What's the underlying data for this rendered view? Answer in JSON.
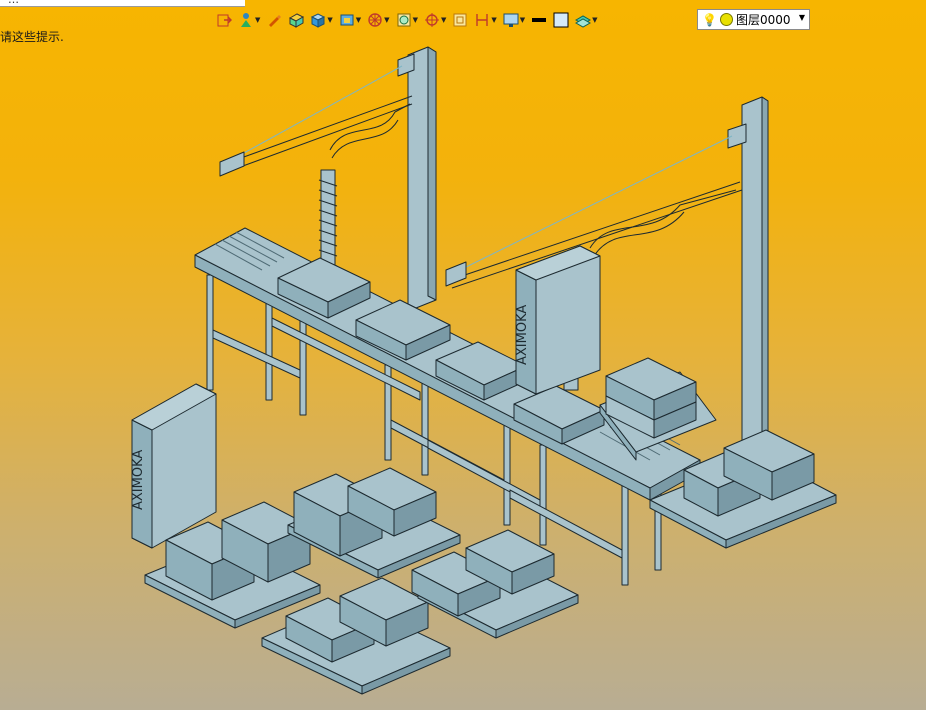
{
  "top_strip": {
    "text": "…"
  },
  "hint_text": "请这些提示.",
  "toolbar": {
    "tools": [
      {
        "icon": "exit-icon",
        "dropdown": false
      },
      {
        "icon": "person-icon",
        "dropdown": true
      },
      {
        "icon": "pen-icon",
        "dropdown": false
      },
      {
        "icon": "solid-box-icon",
        "dropdown": false
      },
      {
        "icon": "cube-icon",
        "dropdown": true
      },
      {
        "icon": "view-cube-icon",
        "dropdown": true
      },
      {
        "icon": "wheel-icon",
        "dropdown": true
      },
      {
        "icon": "section-icon",
        "dropdown": true
      },
      {
        "icon": "target-icon",
        "dropdown": true
      },
      {
        "icon": "frame-icon",
        "dropdown": false
      },
      {
        "icon": "dimension-icon",
        "dropdown": true
      },
      {
        "icon": "display-icon",
        "dropdown": true
      },
      {
        "icon": "line-style-icon",
        "dropdown": false
      },
      {
        "icon": "fill-color-icon",
        "dropdown": false
      },
      {
        "icon": "layers-icon",
        "dropdown": true
      }
    ]
  },
  "layer_selector": {
    "value": "图层0000",
    "bulb": "lightbulb-icon"
  },
  "colors": {
    "bg_top": "#f7b500",
    "bg_bottom": "#b8ad93",
    "model_fill": "#a9c3cc",
    "model_stroke": "#1d2a30"
  }
}
